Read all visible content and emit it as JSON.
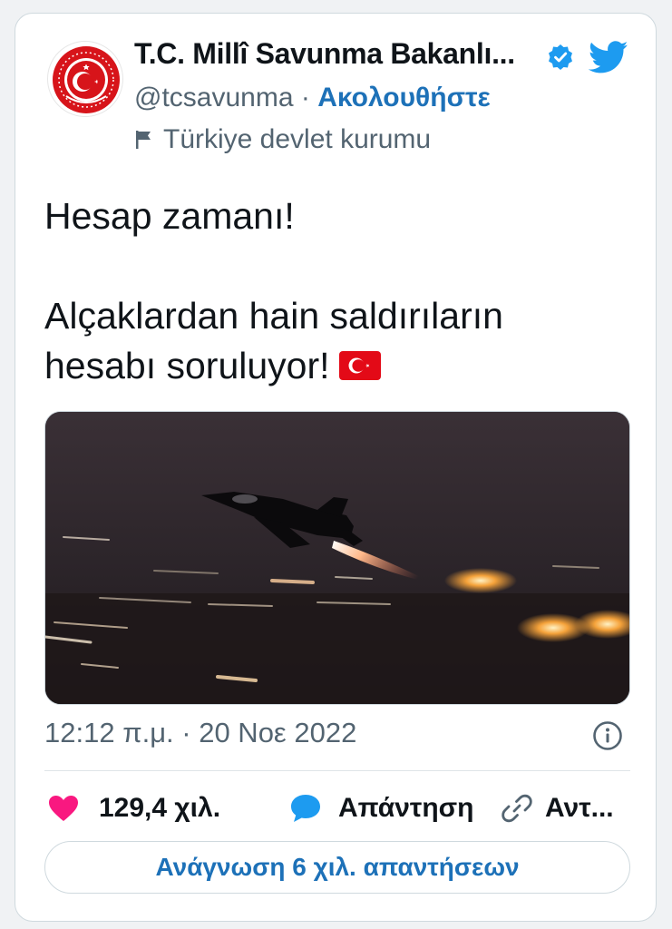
{
  "author": {
    "display_name": "T.C. Millî Savunma Bakanlı...",
    "handle": "@tcsavunma",
    "separator": "·",
    "follow_label": "Ακολουθήστε",
    "account_label": "Türkiye devlet kurumu",
    "avatar_icon": "ministry-emblem-icon",
    "verified_icon": "verified-badge-icon",
    "brand_icon": "twitter-bird-icon"
  },
  "tweet": {
    "line1": "Hesap zamanı!",
    "line2": "Alçaklardan hain saldırıların",
    "line3": "hesabı soruluyor!",
    "emoji_icon": "turkish-flag-icon",
    "media_icon": "fighter-jet-night-photo"
  },
  "meta": {
    "timestamp": "12:12 π.μ. · 20 Νοε 2022",
    "info_icon": "info-icon"
  },
  "actions": {
    "likes": "129,4 χιλ.",
    "reply_label": "Απάντηση",
    "share_label": "Αντ..."
  },
  "footer": {
    "read_replies": "Ανάγνωση 6 χιλ. απαντήσεων"
  },
  "colors": {
    "accent": "#1d71b8",
    "twitter_blue": "#1d9bf0",
    "like_pink": "#f91880",
    "muted": "#536471",
    "emblem_red": "#d7141a"
  }
}
